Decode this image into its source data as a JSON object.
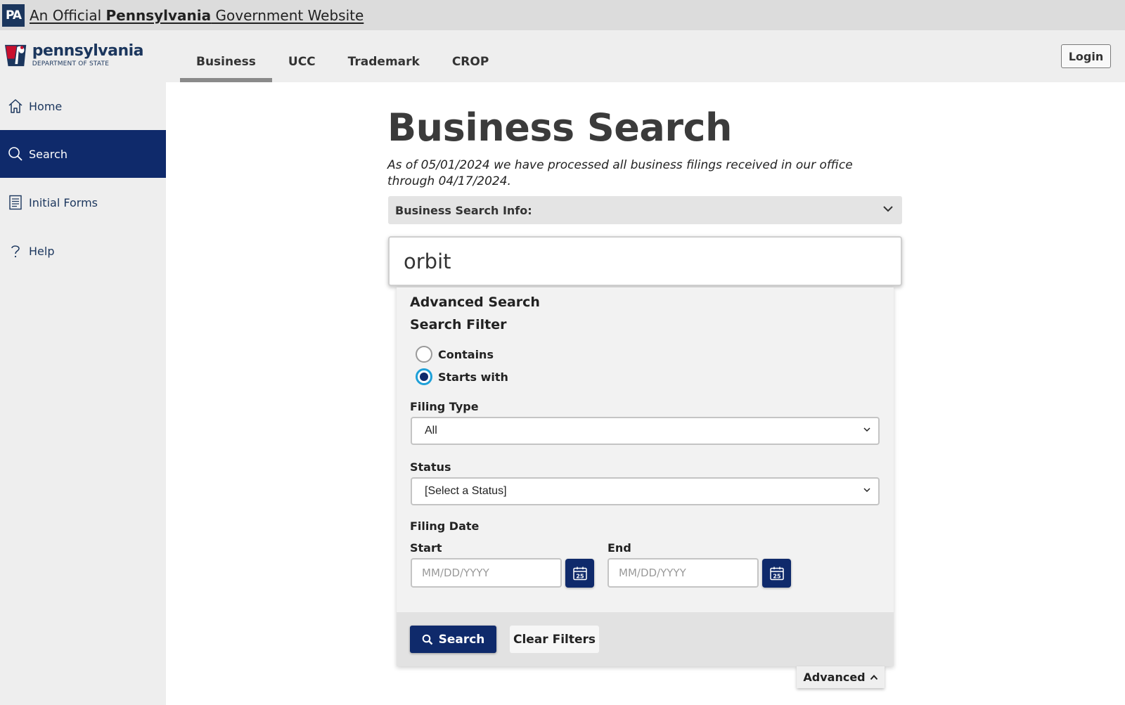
{
  "banner": {
    "badge": "PA",
    "text_pre": "An Official ",
    "text_bold": "Pennsylvania",
    "text_post": " Government Website"
  },
  "header": {
    "logo_name": "pennsylvania",
    "logo_sub": "DEPARTMENT OF STATE",
    "tabs": [
      {
        "label": "Business",
        "active": true
      },
      {
        "label": "UCC",
        "active": false
      },
      {
        "label": "Trademark",
        "active": false
      },
      {
        "label": "CROP",
        "active": false
      }
    ],
    "login_label": "Login"
  },
  "sidebar": {
    "items": [
      {
        "label": "Home",
        "icon": "home-icon",
        "active": false
      },
      {
        "label": "Search",
        "icon": "search-icon",
        "active": true
      },
      {
        "label": "Initial Forms",
        "icon": "forms-icon",
        "active": false
      },
      {
        "label": "Help",
        "icon": "help-icon",
        "active": false
      }
    ]
  },
  "main": {
    "title": "Business Search",
    "notice": "As of 05/01/2024 we have processed all business filings received in our office through 04/17/2024.",
    "info_bar_label": "Business Search Info:",
    "search_value": "orbit"
  },
  "advanced": {
    "title": "Advanced Search",
    "filter_title": "Search Filter",
    "filter_options": [
      {
        "label": "Contains",
        "checked": false
      },
      {
        "label": "Starts with",
        "checked": true
      }
    ],
    "filing_type_label": "Filing Type",
    "filing_type_value": "All",
    "status_label": "Status",
    "status_value": "[Select a Status]",
    "filing_date_label": "Filing Date",
    "start_label": "Start",
    "end_label": "End",
    "date_placeholder": "MM/DD/YYYY",
    "calendar_day": "25",
    "search_button": "Search",
    "clear_button": "Clear Filters",
    "toggle_label": "Advanced"
  },
  "colors": {
    "navy": "#0f2a6b",
    "brand_blue": "#1b365d",
    "radio_focus": "#1ea0d8",
    "banner_bg": "#dcdcdc",
    "sidebar_bg": "#eeeeee"
  }
}
